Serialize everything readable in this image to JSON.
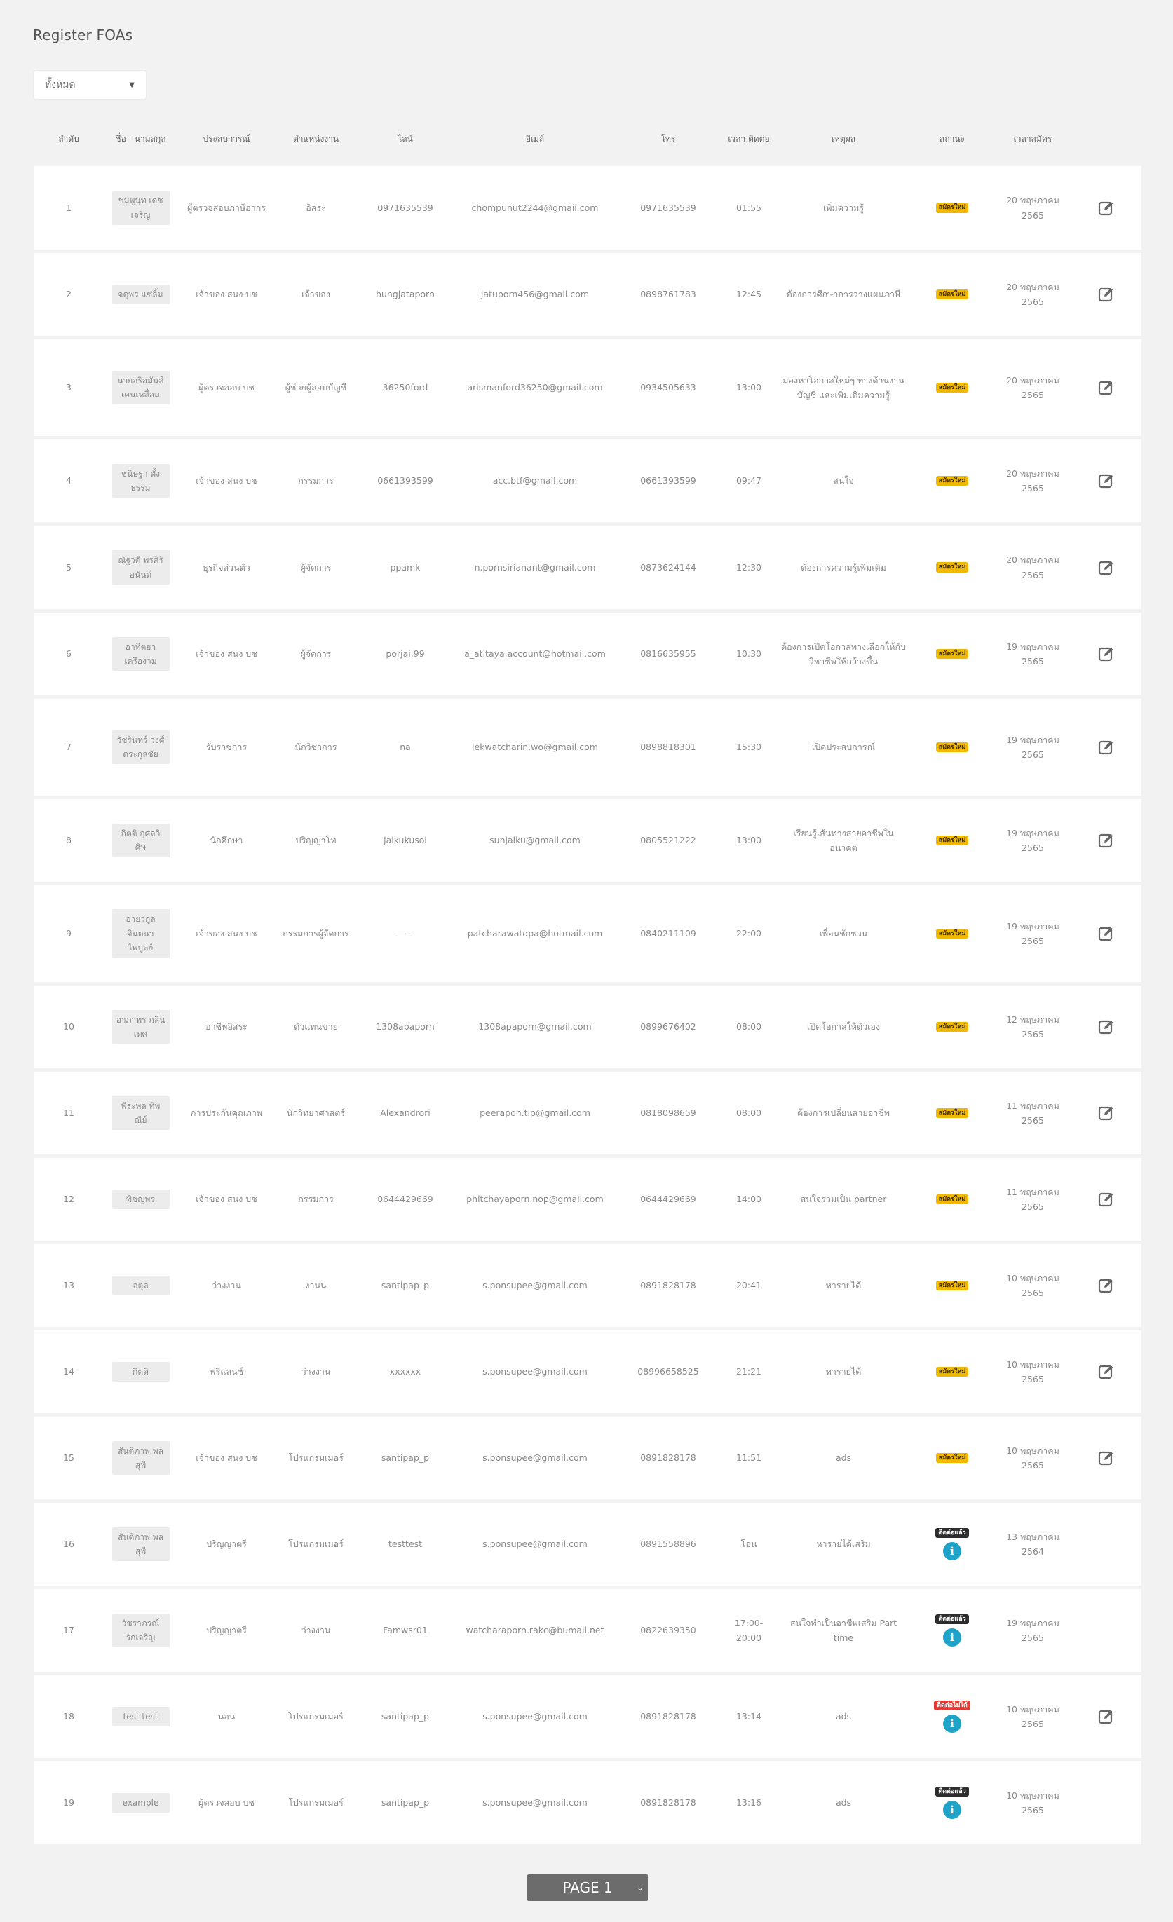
{
  "page": {
    "title": "Register FOAs"
  },
  "filter": {
    "selected": "ทั้งหมด"
  },
  "table": {
    "headers": [
      "ลำดับ",
      "ชื่อ - นามสกุล",
      "ประสบการณ์",
      "ตำแหน่งงาน",
      "ไลน์",
      "อีเมล์",
      "โทร",
      "เวลา ติดต่อ",
      "เหตุผล",
      "สถานะ",
      "เวลาสมัคร",
      ""
    ],
    "rows": [
      {
        "no": "1",
        "name": "ชมพูนุท เดชเจริญ",
        "exp": "ผู้ตรวจสอบภาษีอากร",
        "position": "อิสระ",
        "line": "0971635539",
        "email": "chompunut2244@gmail.com",
        "tel": "0971635539",
        "time": "01:55",
        "reason": "เพิ่มความรู้",
        "status": "สมัครใหม่",
        "status_type": "new",
        "date": "20 พฤษภาคม 2565",
        "edit": true,
        "info": false
      },
      {
        "no": "2",
        "name": "จตุพร แซ่ลิ้ม",
        "exp": "เจ้าของ สนง บช",
        "position": "เจ้าของ",
        "line": "hungjataporn",
        "email": "jatuporn456@gmail.com",
        "tel": "0898761783",
        "time": "12:45",
        "reason": "ต้องการศึกษาการวางแผนภาษี",
        "status": "สมัครใหม่",
        "status_type": "new",
        "date": "20 พฤษภาคม 2565",
        "edit": true,
        "info": false
      },
      {
        "no": "3",
        "name": "นายอริสมันส์ เคนเหลื่อม",
        "exp": "ผู้ตรวจสอบ บช",
        "position": "ผู้ช่วยผู้สอบบัญชี",
        "line": "36250ford",
        "email": "arismanford36250@gmail.com",
        "tel": "0934505633",
        "time": "13:00",
        "reason": "มองหาโอกาสใหม่ๆ ทางด้านงานบัญชี และเพิ่มเติมความรู้",
        "status": "สมัครใหม่",
        "status_type": "new",
        "date": "20 พฤษภาคม 2565",
        "edit": true,
        "info": false
      },
      {
        "no": "4",
        "name": "ชนิษฐา ตั้งธรรม",
        "exp": "เจ้าของ สนง บช",
        "position": "กรรมการ",
        "line": "0661393599",
        "email": "acc.btf@gmail.com",
        "tel": "0661393599",
        "time": "09:47",
        "reason": "สนใจ",
        "status": "สมัครใหม่",
        "status_type": "new",
        "date": "20 พฤษภาคม 2565",
        "edit": true,
        "info": false
      },
      {
        "no": "5",
        "name": "ณัฐวดี พรศิริอนันต์",
        "exp": "ธุรกิจส่วนตัว",
        "position": "ผู้จัดการ",
        "line": "ppamk",
        "email": "n.pornsirianant@gmail.com",
        "tel": "0873624144",
        "time": "12:30",
        "reason": "ต้องการความรู้เพิ่มเติม",
        "status": "สมัครใหม่",
        "status_type": "new",
        "date": "20 พฤษภาคม 2565",
        "edit": true,
        "info": false
      },
      {
        "no": "6",
        "name": "อาทิตยา เครืองาม",
        "exp": "เจ้าของ สนง บช",
        "position": "ผู้จัดการ",
        "line": "porjai.99",
        "email": "a_atitaya.account@hotmail.com",
        "tel": "0816635955",
        "time": "10:30",
        "reason": "ต้องการเปิดโอกาสทางเลือกให้กับวิชาชีพให้กว้างขึ้น",
        "status": "สมัครใหม่",
        "status_type": "new",
        "date": "19 พฤษภาคม 2565",
        "edit": true,
        "info": false
      },
      {
        "no": "7",
        "name": "วัชรินทร์ วงศ์ตระกูลชัย",
        "exp": "รับราชการ",
        "position": "นักวิชาการ",
        "line": "na",
        "email": "lekwatcharin.wo@gmail.com",
        "tel": "0898818301",
        "time": "15:30",
        "reason": "เปิดประสบการณ์",
        "status": "สมัครใหม่",
        "status_type": "new",
        "date": "19 พฤษภาคม 2565",
        "edit": true,
        "info": false
      },
      {
        "no": "8",
        "name": "กิตติ กุศลวิศิษ",
        "exp": "นักศึกษา",
        "position": "ปริญญาโท",
        "line": "jaikukusol",
        "email": "sunjaiku@gmail.com",
        "tel": "0805521222",
        "time": "13:00",
        "reason": "เรียนรู้เส้นทางสายอาชีพในอนาคต",
        "status": "สมัครใหม่",
        "status_type": "new",
        "date": "19 พฤษภาคม 2565",
        "edit": true,
        "info": false
      },
      {
        "no": "9",
        "name": "อายวกูล จินตนา ไพบูลย์",
        "exp": "เจ้าของ สนง บช",
        "position": "กรรมการผู้จัดการ",
        "line": "——",
        "email": "patcharawatdpa@hotmail.com",
        "tel": "0840211109",
        "time": "22:00",
        "reason": "เพื่อนชักชวน",
        "status": "สมัครใหม่",
        "status_type": "new",
        "date": "19 พฤษภาคม 2565",
        "edit": true,
        "info": false
      },
      {
        "no": "10",
        "name": "อาภาพร กลิ่นเทศ",
        "exp": "อาชีพอิสระ",
        "position": "ตัวแทนขาย",
        "line": "1308apaporn",
        "email": "1308apaporn@gmail.com",
        "tel": "0899676402",
        "time": "08:00",
        "reason": "เปิดโอกาสให้ตัวเอง",
        "status": "สมัครใหม่",
        "status_type": "new",
        "date": "12 พฤษภาคม 2565",
        "edit": true,
        "info": false
      },
      {
        "no": "11",
        "name": "พีระพล ทิพณีย์",
        "exp": "การประกันคุณภาพ",
        "position": "นักวิทยาศาสตร์",
        "line": "Alexandrori",
        "email": "peerapon.tip@gmail.com",
        "tel": "0818098659",
        "time": "08:00",
        "reason": "ต้องการเปลี่ยนสายอาชีพ",
        "status": "สมัครใหม่",
        "status_type": "new",
        "date": "11 พฤษภาคม 2565",
        "edit": true,
        "info": false
      },
      {
        "no": "12",
        "name": "พิชญพร",
        "exp": "เจ้าของ สนง บช",
        "position": "กรรมการ",
        "line": "0644429669",
        "email": "phitchayaporn.nop@gmail.com",
        "tel": "0644429669",
        "time": "14:00",
        "reason": "สนใจร่วมเป็น partner",
        "status": "สมัครใหม่",
        "status_type": "new",
        "date": "11 พฤษภาคม 2565",
        "edit": true,
        "info": false
      },
      {
        "no": "13",
        "name": "อตุล",
        "exp": "ว่างงาน",
        "position": "งานน",
        "line": "santipap_p",
        "email": "s.ponsupee@gmail.com",
        "tel": "0891828178",
        "time": "20:41",
        "reason": "หารายได้",
        "status": "สมัครใหม่",
        "status_type": "new",
        "date": "10 พฤษภาคม 2565",
        "edit": true,
        "info": false
      },
      {
        "no": "14",
        "name": "กิตติ",
        "exp": "ฟรีแลนซ์",
        "position": "ว่างงาน",
        "line": "xxxxxx",
        "email": "s.ponsupee@gmail.com",
        "tel": "08996658525",
        "time": "21:21",
        "reason": "หารายได้",
        "status": "สมัครใหม่",
        "status_type": "new",
        "date": "10 พฤษภาคม 2565",
        "edit": true,
        "info": false
      },
      {
        "no": "15",
        "name": "สันติภาพ พลสุพี",
        "exp": "เจ้าของ สนง บช",
        "position": "โปรแกรมเมอร์",
        "line": "santipap_p",
        "email": "s.ponsupee@gmail.com",
        "tel": "0891828178",
        "time": "11:51",
        "reason": "ads",
        "status": "สมัครใหม่",
        "status_type": "new",
        "date": "10 พฤษภาคม 2565",
        "edit": true,
        "info": false
      },
      {
        "no": "16",
        "name": "สันติภาพ พลสุพี",
        "exp": "ปริญญาตรี",
        "position": "โปรแกรมเมอร์",
        "line": "testtest",
        "email": "s.ponsupee@gmail.com",
        "tel": "0891558896",
        "time": "โอน",
        "reason": "หารายได้เสริม",
        "status": "ติดต่อแล้ว",
        "status_type": "contacted",
        "date": "13 พฤษภาคม 2564",
        "edit": false,
        "info": true
      },
      {
        "no": "17",
        "name": "วัชราภรณ์ รักเจริญ",
        "exp": "ปริญญาตรี",
        "position": "ว่างงาน",
        "line": "Famwsr01",
        "email": "watcharaporn.rakc@bumail.net",
        "tel": "0822639350",
        "time": "17:00-20:00",
        "reason": "สนใจทำเป็นอาชีพเสริม Part time",
        "status": "ติดต่อแล้ว",
        "status_type": "contacted",
        "date": "19 พฤษภาคม 2565",
        "edit": false,
        "info": true
      },
      {
        "no": "18",
        "name": "test test",
        "exp": "นอน",
        "position": "โปรแกรมเมอร์",
        "line": "santipap_p",
        "email": "s.ponsupee@gmail.com",
        "tel": "0891828178",
        "time": "13:14",
        "reason": "ads",
        "status": "ติดต่อไม่ได้",
        "status_type": "fail",
        "date": "10 พฤษภาคม 2565",
        "edit": true,
        "info": true
      },
      {
        "no": "19",
        "name": "example",
        "exp": "ผู้ตรวจสอบ บช",
        "position": "โปรแกรมเมอร์",
        "line": "santipap_p",
        "email": "s.ponsupee@gmail.com",
        "tel": "0891828178",
        "time": "13:16",
        "reason": "ads",
        "status": "ติดต่อแล้ว",
        "status_type": "contacted",
        "date": "10 พฤษภาคม 2565",
        "edit": false,
        "info": true
      }
    ]
  },
  "pager": {
    "label": "PAGE 1"
  },
  "colors": {
    "new": "#f1b800",
    "contacted": "#2d2d2d",
    "fail": "#e53935",
    "info": "#1fa3c9"
  }
}
